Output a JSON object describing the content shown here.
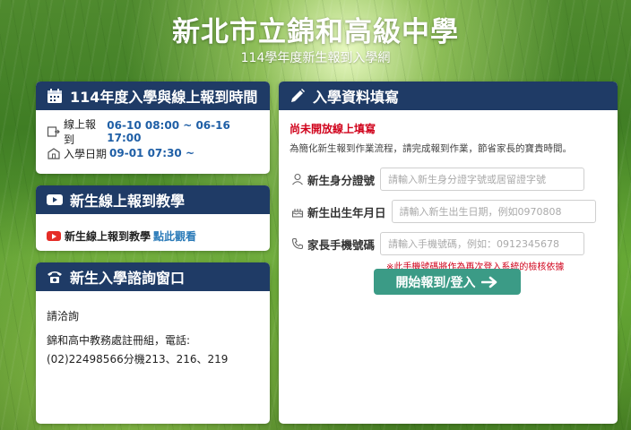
{
  "header": {
    "title": "新北市立錦和高級中學",
    "subtitle": "114學年度新生報到入學網"
  },
  "schedule": {
    "title": "114年度入學與線上報到時間",
    "rows": [
      {
        "label": "線上報到",
        "value": "06-10 08:00 ~ 06-16 17:00"
      },
      {
        "label": "入學日期",
        "value": "09-01 07:30 ~"
      }
    ]
  },
  "tutorial": {
    "title": "新生線上報到教學",
    "text": "新生線上報到教學",
    "link": "點此觀看"
  },
  "contact": {
    "title": "新生入學諮詢窗口",
    "line1": "請洽詢",
    "line2": "錦和高中教務處註冊組，電話:(02)22498566分機213、216、219"
  },
  "form": {
    "title": "入學資料填寫",
    "warning": "尚未開放線上填寫",
    "note": "為簡化新生報到作業流程，請完成報到作業，節省家長的寶貴時間。",
    "fields": [
      {
        "label": "新生身分證號",
        "placeholder": "請輸入新生身分證字號或居留證字號"
      },
      {
        "label": "新生出生年月日",
        "placeholder": "請輸入新生出生日期，例如0970808"
      },
      {
        "label": "家長手機號碼",
        "placeholder": "請輸入手機號碼，例如：0912345678"
      }
    ],
    "phone_hint": "※此手機號碼將作為再次登入系統的檢核依據",
    "submit_label": "開始報到/登入"
  },
  "colors": {
    "header_bar": "#1f3b66",
    "accent_blue": "#1f5fa6",
    "warning_red": "#d0021b",
    "button_teal": "#3b9b86"
  },
  "icons": {
    "schedule": "calendar-icon",
    "tutorial": "youtube-icon",
    "contact": "phone-icon",
    "form": "pencil-icon"
  }
}
